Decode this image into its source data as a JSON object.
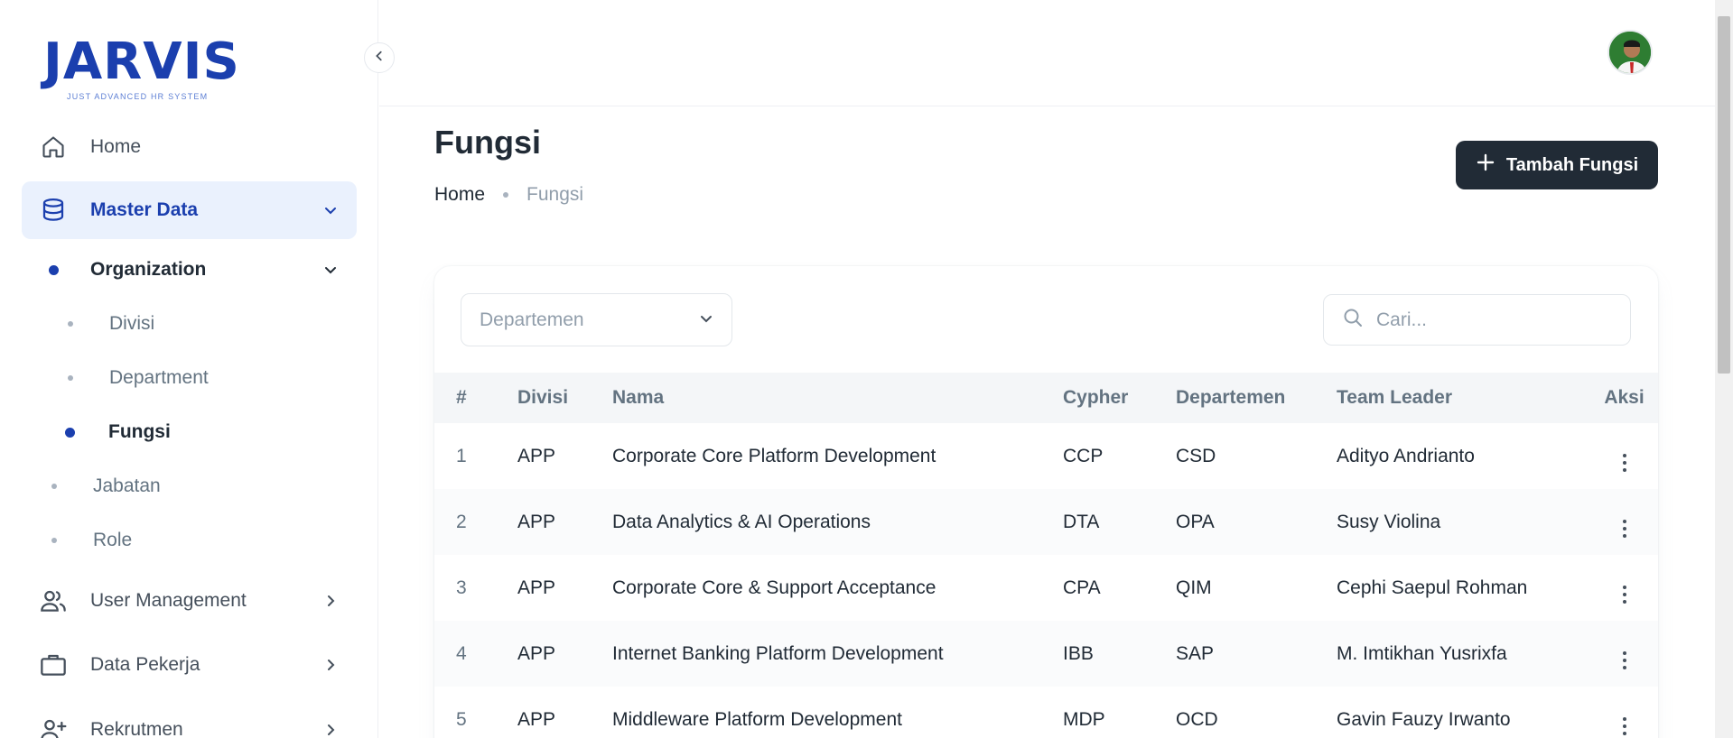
{
  "brand": {
    "name": "JARVIS",
    "tagline": "JUST ADVANCED HR SYSTEM",
    "color": "#1b3fae"
  },
  "sidebar": {
    "items": [
      {
        "label": "Home",
        "icon": "home-icon"
      },
      {
        "label": "Master Data",
        "icon": "database-icon",
        "active": true,
        "expanded": true
      },
      {
        "label": "User Management",
        "icon": "users-icon"
      },
      {
        "label": "Data Pekerja",
        "icon": "briefcase-icon"
      },
      {
        "label": "Rekrutmen",
        "icon": "user-plus-icon"
      }
    ],
    "organization": {
      "label": "Organization",
      "expanded": true
    },
    "org_children": [
      {
        "label": "Divisi"
      },
      {
        "label": "Department"
      },
      {
        "label": "Fungsi",
        "selected": true
      }
    ],
    "master_children": [
      {
        "label": "Jabatan"
      },
      {
        "label": "Role"
      }
    ]
  },
  "page": {
    "title": "Fungsi",
    "breadcrumb": [
      "Home",
      "Fungsi"
    ],
    "add_button": "Tambah Fungsi"
  },
  "filters": {
    "department_placeholder": "Departemen",
    "search_placeholder": "Cari..."
  },
  "table": {
    "headers": [
      "#",
      "Divisi",
      "Nama",
      "Cypher",
      "Departemen",
      "Team Leader",
      "Aksi"
    ],
    "rows": [
      {
        "no": "1",
        "divisi": "APP",
        "nama": "Corporate Core Platform Development",
        "cypher": "CCP",
        "departemen": "CSD",
        "leader": "Adityo Andrianto"
      },
      {
        "no": "2",
        "divisi": "APP",
        "nama": "Data Analytics & AI Operations",
        "cypher": "DTA",
        "departemen": "OPA",
        "leader": "Susy Violina"
      },
      {
        "no": "3",
        "divisi": "APP",
        "nama": "Corporate Core & Support Acceptance",
        "cypher": "CPA",
        "departemen": "QIM",
        "leader": "Cephi Saepul Rohman"
      },
      {
        "no": "4",
        "divisi": "APP",
        "nama": "Internet Banking Platform Development",
        "cypher": "IBB",
        "departemen": "SAP",
        "leader": "M. Imtikhan Yusrixfa"
      },
      {
        "no": "5",
        "divisi": "APP",
        "nama": "Middleware Platform Development",
        "cypher": "MDP",
        "departemen": "OCD",
        "leader": "Gavin Fauzy Irwanto"
      }
    ]
  }
}
